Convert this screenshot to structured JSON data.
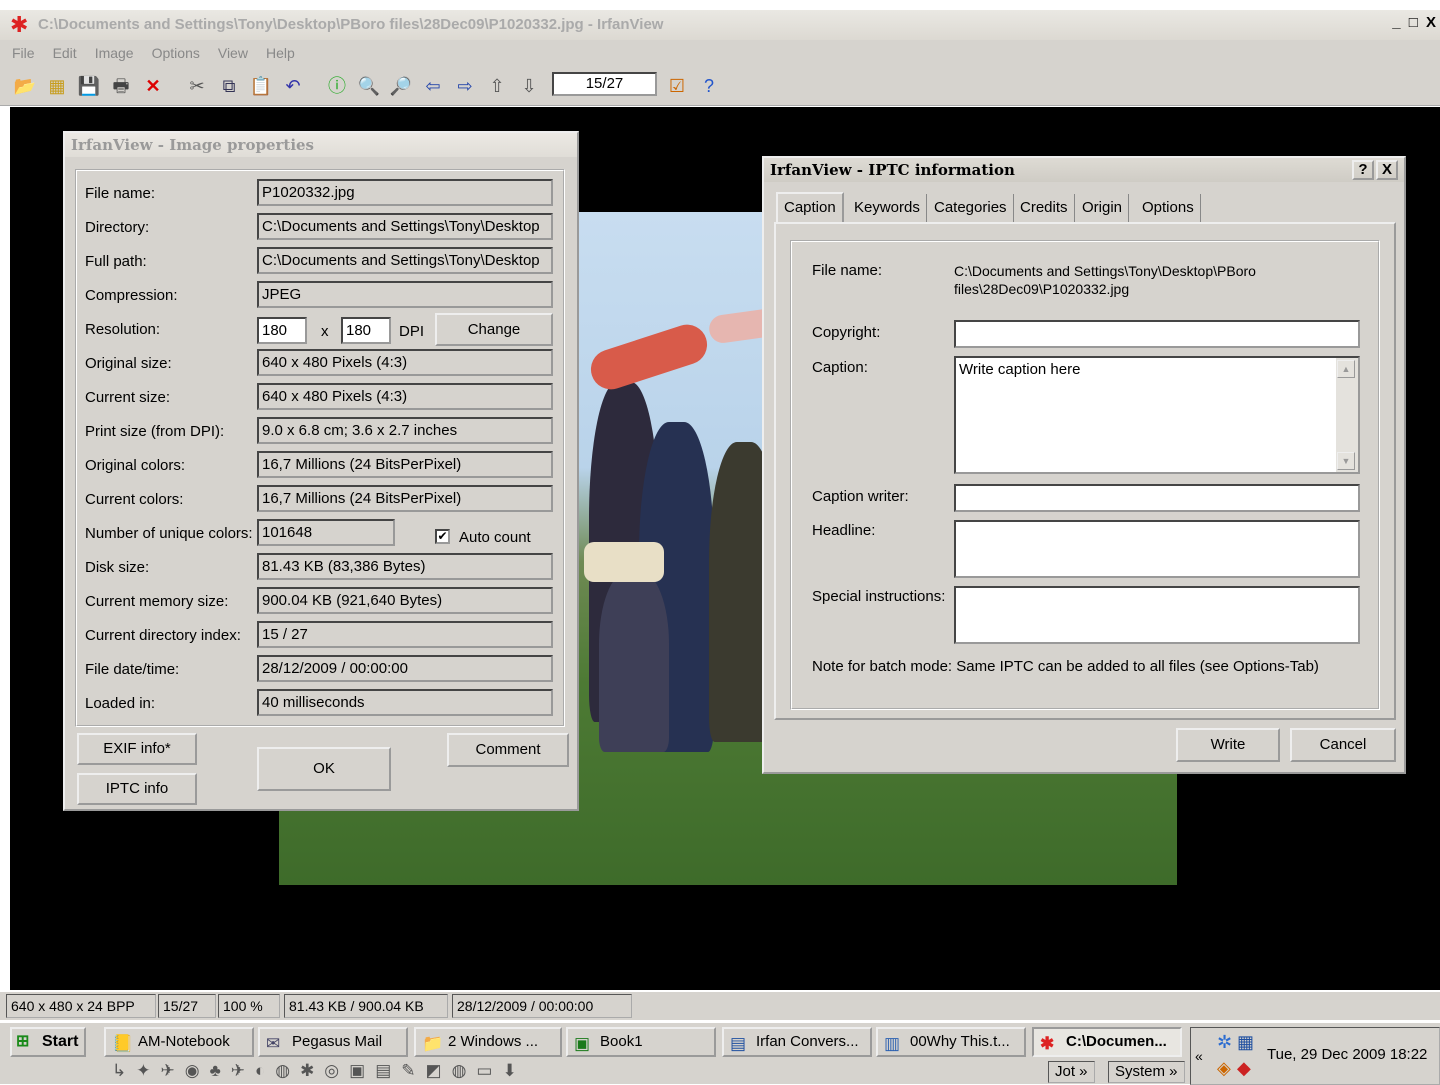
{
  "window": {
    "title": "C:\\Documents and Settings\\Tony\\Desktop\\PBoro files\\28Dec09\\P1020332.jpg - IrfanView",
    "controls": "_ □ X"
  },
  "menu": [
    "File",
    "Edit",
    "Image",
    "Options",
    "View",
    "Help"
  ],
  "toolbar": {
    "page_indicator": "15/27",
    "icons": [
      "open-icon",
      "thumbnails-icon",
      "save-icon",
      "print-icon",
      "delete-icon",
      "cut-icon",
      "copy-icon",
      "paste-icon",
      "undo-icon",
      "info-icon",
      "zoom-in-icon",
      "zoom-out-icon",
      "prev-icon",
      "next-icon",
      "first-icon",
      "last-icon",
      "options-icon",
      "help-icon"
    ]
  },
  "status": [
    "640 x 480 x 24 BPP",
    "15/27",
    "100 %",
    "81.43 KB / 900.04 KB",
    "28/12/2009 / 00:00:00"
  ],
  "props": {
    "title": "IrfanView - Image properties",
    "rows": [
      {
        "label": "File name:",
        "value": "P1020332.jpg"
      },
      {
        "label": "Directory:",
        "value": "C:\\Documents and Settings\\Tony\\Desktop"
      },
      {
        "label": "Full path:",
        "value": "C:\\Documents and Settings\\Tony\\Desktop"
      },
      {
        "label": "Compression:",
        "value": "JPEG"
      },
      {
        "label": "Resolution:",
        "value": ""
      },
      {
        "label": "Original size:",
        "value": "640 x 480  Pixels (4:3)"
      },
      {
        "label": "Current size:",
        "value": "640 x 480  Pixels (4:3)"
      },
      {
        "label": "Print size (from DPI):",
        "value": "9.0 x 6.8 cm; 3.6 x 2.7 inches"
      },
      {
        "label": "Original colors:",
        "value": "16,7 Millions   (24 BitsPerPixel)"
      },
      {
        "label": "Current colors:",
        "value": "16,7 Millions   (24 BitsPerPixel)"
      },
      {
        "label": "Number of unique colors:",
        "value": "101648"
      },
      {
        "label": "Disk size:",
        "value": "81.43 KB (83,386 Bytes)"
      },
      {
        "label": "Current memory size:",
        "value": "900.04  KB (921,640 Bytes)"
      },
      {
        "label": "Current directory index:",
        "value": "15  /  27"
      },
      {
        "label": "File date/time:",
        "value": "28/12/2009 / 00:00:00"
      },
      {
        "label": "Loaded in:",
        "value": "40 milliseconds"
      }
    ],
    "res_x": "180",
    "res_times": "x",
    "res_y": "180",
    "res_unit": "DPI",
    "change": "Change",
    "auto_count": "Auto count",
    "exif": "EXIF info*",
    "iptc": "IPTC info",
    "ok": "OK",
    "comment": "Comment"
  },
  "iptc": {
    "title": "IrfanView - IPTC information",
    "help": "?",
    "close": "X",
    "tabs": [
      "Caption",
      "Keywords",
      "Categories",
      "Credits",
      "Origin",
      "Options"
    ],
    "file_label": "File name:",
    "file_value": "C:\\Documents and Settings\\Tony\\Desktop\\PBoro files\\28Dec09\\P1020332.jpg",
    "copyright_label": "Copyright:",
    "copyright_value": "",
    "caption_label": "Caption:",
    "caption_value": "Write caption here",
    "writer_label": "Caption writer:",
    "writer_value": "",
    "headline_label": "Headline:",
    "headline_value": "",
    "special_label": "Special instructions:",
    "special_value": "",
    "note": "Note for batch mode: Same IPTC can be added to all files (see Options-Tab)",
    "write": "Write",
    "cancel": "Cancel"
  },
  "taskbar": {
    "start": "Start",
    "tasks": [
      "AM-Notebook",
      "Pegasus Mail",
      "2 Windows ...",
      "Book1",
      "Irfan Convers...",
      "00Why This.t...",
      "C:\\Documen..."
    ],
    "jot": "Jot",
    "system": "System",
    "clock": "Tue, 29 Dec 2009  18:22"
  }
}
